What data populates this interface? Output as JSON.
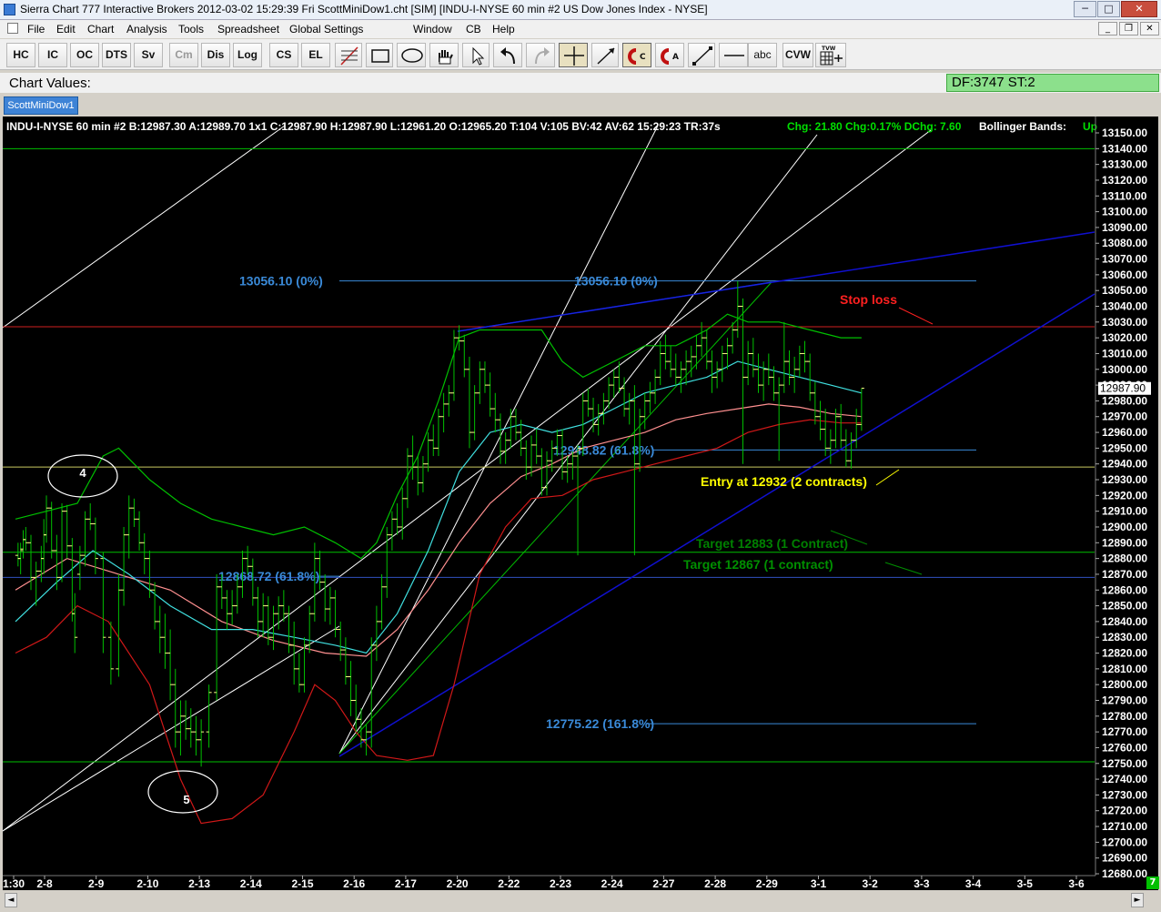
{
  "window": {
    "title": "Sierra Chart 777 Interactive Brokers 2012-03-02  15:29:39 Fri  ScottMiniDow1.cht [SIM]  [INDU-I-NYSE  60 min  #2  US Dow Jones Index - NYSE]",
    "btn_min": "─",
    "btn_max": "□",
    "btn_close": "✕"
  },
  "menu": [
    "File",
    "Edit",
    "Chart",
    "Analysis",
    "Tools",
    "Spreadsheet",
    "Global Settings",
    "Window",
    "CB",
    "Help"
  ],
  "mdi": {
    "min": "_",
    "restore": "❐",
    "close": "✕"
  },
  "toolbar": {
    "text_buttons": [
      "HC",
      "IC",
      "OC",
      "DTS",
      "Sv",
      "Cm",
      "Dis",
      "Log",
      "CS",
      "EL"
    ],
    "abc": "abc",
    "cvw": "CVW",
    "tick_label": "TVW",
    "icons": [
      "fib-icon",
      "rectangle-icon",
      "ellipse-icon",
      "hand-icon",
      "pointer-icon",
      "undo-icon",
      "redo-icon",
      "crosshair-icon",
      "ray-icon",
      "magnet-c-icon",
      "magnet-a-icon",
      "line-icon",
      "horizontal-line-icon",
      "calc-icon"
    ]
  },
  "chart_values_label": "Chart Values:",
  "df_status": "DF:3747  ST:2",
  "tab": "ScottMiniDow1",
  "chart_header": "INDU-I-NYSE  60 min  #2 B:12987.30 A:12989.70 1x1 C:12987.90 H:12987.90 L:12961.20 O:12965.20 T:104 V:105 BV:42 AV:62 15:29:23 TR:37s",
  "chart_header_chg": "Chg: 21.80  Chg:0.17%  DChg: 7.60",
  "chart_header_bb": "Bollinger Bands:",
  "chart_header_up": "Up",
  "chart_data": {
    "type": "line",
    "title": "",
    "symbol": "INDU-I-NYSE",
    "interval": "60 min",
    "ylim": [
      12680,
      13150
    ],
    "y_ticks": [
      "13150.00",
      "13140.00",
      "13130.00",
      "13120.00",
      "13110.00",
      "13100.00",
      "13090.00",
      "13080.00",
      "13070.00",
      "13060.00",
      "13050.00",
      "13040.00",
      "13030.00",
      "13020.00",
      "13010.00",
      "13000.00",
      "12990.00",
      "12980.00",
      "12970.00",
      "12960.00",
      "12950.00",
      "12940.00",
      "12930.00",
      "12920.00",
      "12910.00",
      "12900.00",
      "12890.00",
      "12880.00",
      "12870.00",
      "12860.00",
      "12850.00",
      "12840.00",
      "12830.00",
      "12820.00",
      "12810.00",
      "12800.00",
      "12790.00",
      "12780.00",
      "12770.00",
      "12760.00",
      "12750.00",
      "12740.00",
      "12730.00",
      "12720.00",
      "12710.00",
      "12700.00",
      "12690.00",
      "12680.00"
    ],
    "x_ticks": [
      {
        "label": "1:30",
        "i": 0
      },
      {
        "label": "2-8",
        "i": 1
      },
      {
        "label": "2-9",
        "i": 2
      },
      {
        "label": "2-10",
        "i": 3
      },
      {
        "label": "2-13",
        "i": 4
      },
      {
        "label": "2-14",
        "i": 5
      },
      {
        "label": "2-15",
        "i": 6
      },
      {
        "label": "2-16",
        "i": 7
      },
      {
        "label": "2-17",
        "i": 8
      },
      {
        "label": "2-20",
        "i": 9
      },
      {
        "label": "2-22",
        "i": 10
      },
      {
        "label": "2-23",
        "i": 11
      },
      {
        "label": "2-24",
        "i": 12
      },
      {
        "label": "2-27",
        "i": 13
      },
      {
        "label": "2-28",
        "i": 14
      },
      {
        "label": "2-29",
        "i": 15
      },
      {
        "label": "3-1",
        "i": 16
      },
      {
        "label": "3-2",
        "i": 17
      },
      {
        "label": "3-3",
        "i": 18
      },
      {
        "label": "3-4",
        "i": 19
      },
      {
        "label": "3-5",
        "i": 20
      },
      {
        "label": "3-6",
        "i": 21
      }
    ],
    "last_price": "12987.90",
    "price_bars": [
      [
        0.05,
        12882,
        12890,
        12875,
        12880
      ],
      [
        0.1,
        12880,
        12890,
        12870,
        12885
      ],
      [
        0.15,
        12886,
        12898,
        12880,
        12892
      ],
      [
        0.2,
        12892,
        12900,
        12885,
        12890
      ],
      [
        0.3,
        12890,
        12895,
        12860,
        12868
      ],
      [
        0.4,
        12868,
        12878,
        12850,
        12872
      ],
      [
        0.5,
        12872,
        12888,
        12865,
        12880
      ],
      [
        0.55,
        12880,
        12905,
        12870,
        12895
      ],
      [
        0.6,
        12895,
        12920,
        12890,
        12912
      ],
      [
        0.7,
        12912,
        12916,
        12880,
        12885
      ],
      [
        0.8,
        12885,
        12895,
        12860,
        12868
      ],
      [
        0.9,
        12868,
        12915,
        12865,
        12910
      ],
      [
        1.0,
        12910,
        12914,
        12880,
        12888
      ],
      [
        1.1,
        12888,
        12893,
        12840,
        12845
      ],
      [
        1.15,
        12845,
        12858,
        12820,
        12830
      ],
      [
        1.25,
        12870,
        12888,
        12860,
        12882
      ],
      [
        1.35,
        12882,
        12910,
        12875,
        12905
      ],
      [
        1.45,
        12905,
        12915,
        12898,
        12902
      ],
      [
        1.55,
        12902,
        12906,
        12870,
        12880
      ],
      [
        1.7,
        12880,
        12884,
        12820,
        12830
      ],
      [
        1.85,
        12830,
        12840,
        12800,
        12810
      ],
      [
        2.0,
        12810,
        12870,
        12805,
        12860
      ],
      [
        2.1,
        12860,
        12900,
        12850,
        12895
      ],
      [
        2.2,
        12895,
        12920,
        12880,
        12912
      ],
      [
        2.3,
        12912,
        12918,
        12900,
        12905
      ],
      [
        2.4,
        12905,
        12910,
        12885,
        12890
      ],
      [
        2.5,
        12890,
        12896,
        12870,
        12880
      ],
      [
        2.6,
        12880,
        12885,
        12855,
        12860
      ],
      [
        2.7,
        12860,
        12865,
        12835,
        12840
      ],
      [
        2.8,
        12840,
        12850,
        12820,
        12830
      ],
      [
        2.9,
        12830,
        12845,
        12810,
        12820
      ],
      [
        3.0,
        12820,
        12835,
        12790,
        12800
      ],
      [
        3.1,
        12800,
        12810,
        12760,
        12770
      ],
      [
        3.2,
        12770,
        12790,
        12755,
        12780
      ],
      [
        3.3,
        12780,
        12790,
        12765,
        12772
      ],
      [
        3.4,
        12772,
        12785,
        12760,
        12770
      ],
      [
        3.5,
        12770,
        12780,
        12755,
        12765
      ],
      [
        3.6,
        12765,
        12778,
        12748,
        12770
      ],
      [
        3.75,
        12770,
        12800,
        12760,
        12795
      ],
      [
        3.9,
        12795,
        12870,
        12790,
        12862
      ],
      [
        4.0,
        12862,
        12870,
        12848,
        12855
      ],
      [
        4.1,
        12855,
        12860,
        12835,
        12845
      ],
      [
        4.2,
        12845,
        12860,
        12838,
        12850
      ],
      [
        4.3,
        12850,
        12870,
        12845,
        12862
      ],
      [
        4.4,
        12862,
        12885,
        12855,
        12880
      ],
      [
        4.5,
        12880,
        12888,
        12870,
        12875
      ],
      [
        4.6,
        12875,
        12880,
        12850,
        12855
      ],
      [
        4.7,
        12855,
        12862,
        12830,
        12840
      ],
      [
        4.8,
        12840,
        12858,
        12830,
        12850
      ],
      [
        4.9,
        12850,
        12856,
        12825,
        12830
      ],
      [
        5.0,
        12830,
        12850,
        12822,
        12845
      ],
      [
        5.1,
        12845,
        12856,
        12835,
        12850
      ],
      [
        5.2,
        12850,
        12860,
        12840,
        12845
      ],
      [
        5.3,
        12845,
        12850,
        12820,
        12825
      ],
      [
        5.4,
        12825,
        12840,
        12800,
        12810
      ],
      [
        5.5,
        12810,
        12820,
        12795,
        12800
      ],
      [
        5.6,
        12800,
        12830,
        12795,
        12825
      ],
      [
        5.7,
        12825,
        12850,
        12820,
        12845
      ],
      [
        5.8,
        12845,
        12890,
        12840,
        12880
      ],
      [
        5.9,
        12880,
        12885,
        12860,
        12865
      ],
      [
        6.0,
        12865,
        12870,
        12840,
        12848
      ],
      [
        6.1,
        12848,
        12862,
        12838,
        12855
      ],
      [
        6.2,
        12855,
        12860,
        12830,
        12835
      ],
      [
        6.3,
        12835,
        12840,
        12815,
        12822
      ],
      [
        6.4,
        12822,
        12830,
        12800,
        12805
      ],
      [
        6.5,
        12805,
        12815,
        12780,
        12790
      ],
      [
        6.6,
        12790,
        12800,
        12770,
        12778
      ],
      [
        6.7,
        12778,
        12785,
        12760,
        12765
      ],
      [
        6.8,
        12765,
        12775,
        12755,
        12770
      ],
      [
        6.9,
        12770,
        12830,
        12760,
        12825
      ],
      [
        7.0,
        12825,
        12850,
        12815,
        12840
      ],
      [
        7.1,
        12840,
        12870,
        12835,
        12862
      ],
      [
        7.2,
        12862,
        12900,
        12855,
        12895
      ],
      [
        7.3,
        12895,
        12910,
        12885,
        12905
      ],
      [
        7.4,
        12905,
        12915,
        12895,
        12900
      ],
      [
        7.5,
        12900,
        12925,
        12892,
        12918
      ],
      [
        7.6,
        12918,
        12950,
        12912,
        12945
      ],
      [
        7.7,
        12945,
        12958,
        12930,
        12938
      ],
      [
        7.8,
        12938,
        12945,
        12920,
        12928
      ],
      [
        7.9,
        12928,
        12945,
        12922,
        12940
      ],
      [
        8.0,
        12940,
        12960,
        12935,
        12955
      ],
      [
        8.1,
        12955,
        12965,
        12945,
        12950
      ],
      [
        8.2,
        12950,
        12975,
        12945,
        12970
      ],
      [
        8.3,
        12970,
        12985,
        12960,
        12978
      ],
      [
        8.4,
        12978,
        12990,
        12970,
        12985
      ],
      [
        8.5,
        12985,
        13025,
        12980,
        13020
      ],
      [
        8.6,
        13020,
        13028,
        13012,
        13018
      ],
      [
        8.7,
        13018,
        13022,
        12995,
        13000
      ],
      [
        8.8,
        13000,
        13008,
        12950,
        12960
      ],
      [
        8.9,
        12960,
        12990,
        12955,
        12985
      ],
      [
        9.0,
        12985,
        13005,
        12978,
        13000
      ],
      [
        9.1,
        13000,
        13005,
        12985,
        12990
      ],
      [
        9.2,
        12990,
        12998,
        12970,
        12975
      ],
      [
        9.3,
        12975,
        12985,
        12960,
        12968
      ],
      [
        9.4,
        12968,
        12972,
        12940,
        12948
      ],
      [
        9.5,
        12948,
        12960,
        12940,
        12955
      ],
      [
        9.6,
        12955,
        12975,
        12950,
        12970
      ],
      [
        9.7,
        12970,
        12975,
        12955,
        12960
      ],
      [
        9.8,
        12960,
        12968,
        12945,
        12950
      ],
      [
        9.9,
        12950,
        12955,
        12930,
        12938
      ],
      [
        10.0,
        12938,
        12958,
        12932,
        12952
      ],
      [
        10.1,
        12952,
        12962,
        12940,
        12945
      ],
      [
        10.2,
        12945,
        12950,
        12920,
        12925
      ],
      [
        10.3,
        12925,
        12948,
        12920,
        12942
      ],
      [
        10.4,
        12942,
        12955,
        12935,
        12950
      ],
      [
        10.5,
        12950,
        12962,
        12945,
        12958
      ],
      [
        10.6,
        12958,
        12962,
        12930,
        12935
      ],
      [
        10.7,
        12935,
        12945,
        12928,
        12940
      ],
      [
        10.8,
        12940,
        12948,
        12930,
        12945
      ],
      [
        10.9,
        12945,
        12952,
        12882,
        12950
      ],
      [
        11.0,
        12950,
        12985,
        12945,
        12980
      ],
      [
        11.1,
        12980,
        12988,
        12970,
        12975
      ],
      [
        11.2,
        12975,
        12982,
        12960,
        12965
      ],
      [
        11.3,
        12965,
        12978,
        12958,
        12972
      ],
      [
        11.4,
        12972,
        12985,
        12965,
        12980
      ],
      [
        11.5,
        12980,
        12995,
        12975,
        12990
      ],
      [
        11.6,
        12990,
        13000,
        12982,
        12995
      ],
      [
        11.7,
        12995,
        13005,
        12985,
        12988
      ],
      [
        11.8,
        12988,
        12995,
        12970,
        12975
      ],
      [
        11.9,
        12975,
        12985,
        12965,
        12980
      ],
      [
        12.0,
        12980,
        12990,
        12882,
        12940
      ],
      [
        12.1,
        12940,
        12975,
        12935,
        12970
      ],
      [
        12.2,
        12970,
        12985,
        12962,
        12980
      ],
      [
        12.3,
        12980,
        12992,
        12972,
        12985
      ],
      [
        12.4,
        12985,
        13000,
        12978,
        12995
      ],
      [
        12.5,
        12995,
        13018,
        12990,
        13010
      ],
      [
        12.6,
        13010,
        13022,
        13000,
        13005
      ],
      [
        12.7,
        13005,
        13015,
        12995,
        13000
      ],
      [
        12.8,
        13000,
        13010,
        12990,
        12995
      ],
      [
        12.9,
        12995,
        13005,
        12985,
        13000
      ],
      [
        13.0,
        13000,
        13012,
        12990,
        13005
      ],
      [
        13.1,
        13005,
        13015,
        12995,
        13008
      ],
      [
        13.2,
        13008,
        13022,
        13000,
        13015
      ],
      [
        13.3,
        13015,
        13030,
        13008,
        13020
      ],
      [
        13.4,
        13020,
        13025,
        13000,
        13005
      ],
      [
        13.5,
        13005,
        13012,
        12985,
        12995
      ],
      [
        13.6,
        12995,
        13005,
        12988,
        13000
      ],
      [
        13.7,
        13000,
        13015,
        12992,
        13010
      ],
      [
        13.8,
        13010,
        13020,
        13000,
        13015
      ],
      [
        13.9,
        13015,
        13030,
        13010,
        13025
      ],
      [
        14.0,
        13025,
        13056,
        13020,
        13040
      ],
      [
        14.1,
        13040,
        13045,
        12940,
        12995
      ],
      [
        14.2,
        12995,
        13018,
        12990,
        13010
      ],
      [
        14.3,
        13010,
        13020,
        12995,
        13000
      ],
      [
        14.4,
        13000,
        13010,
        12985,
        12990
      ],
      [
        14.5,
        12990,
        13005,
        12980,
        13000
      ],
      [
        14.6,
        13000,
        13010,
        12990,
        12995
      ],
      [
        14.7,
        12995,
        13002,
        12980,
        12985
      ],
      [
        14.8,
        12985,
        12995,
        12942,
        12990
      ],
      [
        14.9,
        12990,
        13030,
        12985,
        13005
      ],
      [
        15.0,
        13005,
        13012,
        12990,
        12995
      ],
      [
        15.1,
        12995,
        13008,
        12985,
        13000
      ],
      [
        15.2,
        13000,
        13015,
        12995,
        13010
      ],
      [
        15.3,
        13010,
        13018,
        12998,
        13005
      ],
      [
        15.4,
        13005,
        13010,
        12980,
        12985
      ],
      [
        15.5,
        12985,
        12992,
        12965,
        12970
      ],
      [
        15.6,
        12970,
        12980,
        12955,
        12962
      ],
      [
        15.7,
        12962,
        12975,
        12945,
        12950
      ],
      [
        15.8,
        12950,
        12962,
        12940,
        12955
      ],
      [
        15.9,
        12955,
        12975,
        12950,
        12970
      ],
      [
        16.0,
        12970,
        12978,
        12950,
        12955
      ],
      [
        16.1,
        12955,
        12962,
        12938,
        12942
      ],
      [
        16.2,
        12942,
        12960,
        12937,
        12955
      ],
      [
        16.3,
        12955,
        12975,
        12950,
        12965
      ],
      [
        16.4,
        12965,
        12988,
        12961,
        12988
      ]
    ],
    "stop_loss": 13027,
    "entry": 12938,
    "target1": 12884,
    "target2": 12868,
    "support": 12751,
    "resistance": 13140,
    "fib_lines": [
      {
        "label": "13056.10 (0%)",
        "value": 13056.1
      },
      {
        "label": "12948.82 (61.8%)",
        "value": 12948.82
      },
      {
        "label": "12868.72 (61.8%)",
        "value": 12868.72
      },
      {
        "label": "12775.22 (161.8%)",
        "value": 12775.22
      }
    ],
    "annotations": [
      {
        "text": "Stop loss",
        "color": "#ff2020"
      },
      {
        "text": "Entry at 12932 (2 contracts)",
        "color": "#ffff00"
      },
      {
        "text": "Target 12883 (1 Contract)",
        "color": "#008000"
      },
      {
        "text": "Target 12867 (1 contract)",
        "color": "#009000"
      }
    ],
    "wave_labels": [
      "4",
      "5"
    ],
    "colors": {
      "background": "#000000",
      "bars": "#ffff88",
      "fib": "#3a8ad8",
      "upper_band": "#00c000",
      "lower_band": "#d01818",
      "mid_band": "#ff9090",
      "ma_cyan": "#40e0e0",
      "trendline_blue": "#1010d0",
      "channel_white": "#ffffff"
    }
  },
  "scroll": {
    "left": "◄",
    "right": "►"
  },
  "corner_badge": "7"
}
